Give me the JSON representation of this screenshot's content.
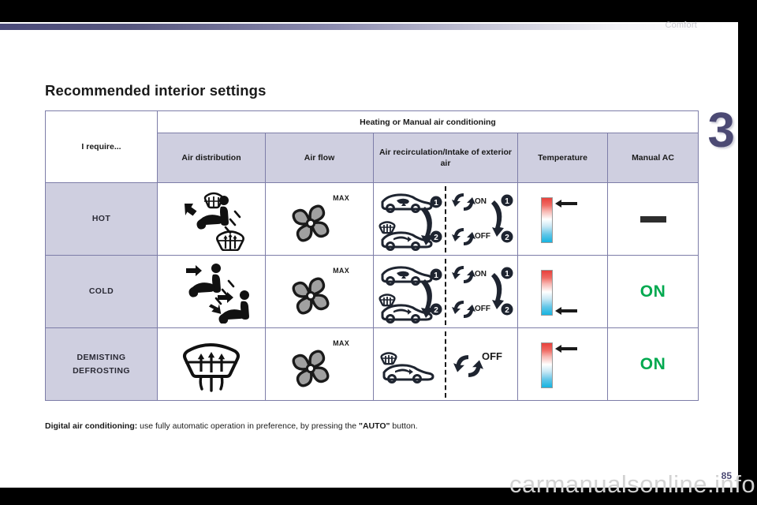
{
  "header": {
    "section_label": "Comfort",
    "chapter_number": "3"
  },
  "page": {
    "title": "Recommended interior settings",
    "page_number": "85",
    "watermark": "carmanualsonline.info"
  },
  "table": {
    "first_column_header": "I require...",
    "group_header": "Heating or Manual air conditioning",
    "columns": [
      {
        "label": "Air distribution"
      },
      {
        "label": "Air flow"
      },
      {
        "label": "Air recirculation/Intake of exterior air"
      },
      {
        "label": "Temperature"
      },
      {
        "label": "Manual AC"
      }
    ],
    "rows": [
      {
        "label": "HOT",
        "air_distribution": "feet-and-windscreen-vents-icon",
        "air_flow": {
          "icon": "fan-icon",
          "label": "MAX"
        },
        "recirculation": {
          "left_icon": "car-recirculation-sequence-icon",
          "steps_left": [
            "1",
            "2"
          ],
          "right_icons": [
            "recirculation-on-icon",
            "recirculation-off-icon"
          ],
          "right_labels": [
            "ON",
            "OFF"
          ],
          "steps_right": [
            "1",
            "2"
          ]
        },
        "temperature": {
          "icon": "temperature-gauge-icon",
          "arrow": "hot-top"
        },
        "manual_ac": {
          "type": "dash",
          "label": ""
        }
      },
      {
        "label": "COLD",
        "air_distribution": "face-level-vents-icon",
        "air_flow": {
          "icon": "fan-icon",
          "label": "MAX"
        },
        "recirculation": {
          "left_icon": "car-recirculation-sequence-icon",
          "steps_left": [
            "1",
            "2"
          ],
          "right_icons": [
            "recirculation-on-icon",
            "recirculation-off-icon"
          ],
          "right_labels": [
            "ON",
            "OFF"
          ],
          "steps_right": [
            "1",
            "2"
          ]
        },
        "temperature": {
          "icon": "temperature-gauge-icon",
          "arrow": "cold-bottom"
        },
        "manual_ac": {
          "type": "text",
          "label": "ON"
        }
      },
      {
        "label": "DEMISTING DEFROSTING",
        "label_line1": "DEMISTING",
        "label_line2": "DEFROSTING",
        "air_distribution": "windscreen-demist-icon",
        "air_flow": {
          "icon": "fan-icon",
          "label": "MAX"
        },
        "recirculation": {
          "left_icon": "car-exterior-air-intake-icon",
          "right_icons": [
            "recirculation-off-icon"
          ],
          "right_labels": [
            "OFF"
          ]
        },
        "temperature": {
          "icon": "temperature-gauge-icon",
          "arrow": "hot-top"
        },
        "manual_ac": {
          "type": "text",
          "label": "ON"
        }
      }
    ]
  },
  "footnote": {
    "bold_lead": "Digital air conditioning:",
    "body": " use fully automatic operation in preference, by pressing the ",
    "quoted": "\"AUTO\"",
    "tail": " button."
  },
  "colors": {
    "header_fill": "#cfcfe0",
    "border": "#7d7da8",
    "chapter": "#4c4a74",
    "ac_on_green": "#00a94f",
    "temp_hot": "#e8413c",
    "temp_cold": "#16b4e0"
  }
}
